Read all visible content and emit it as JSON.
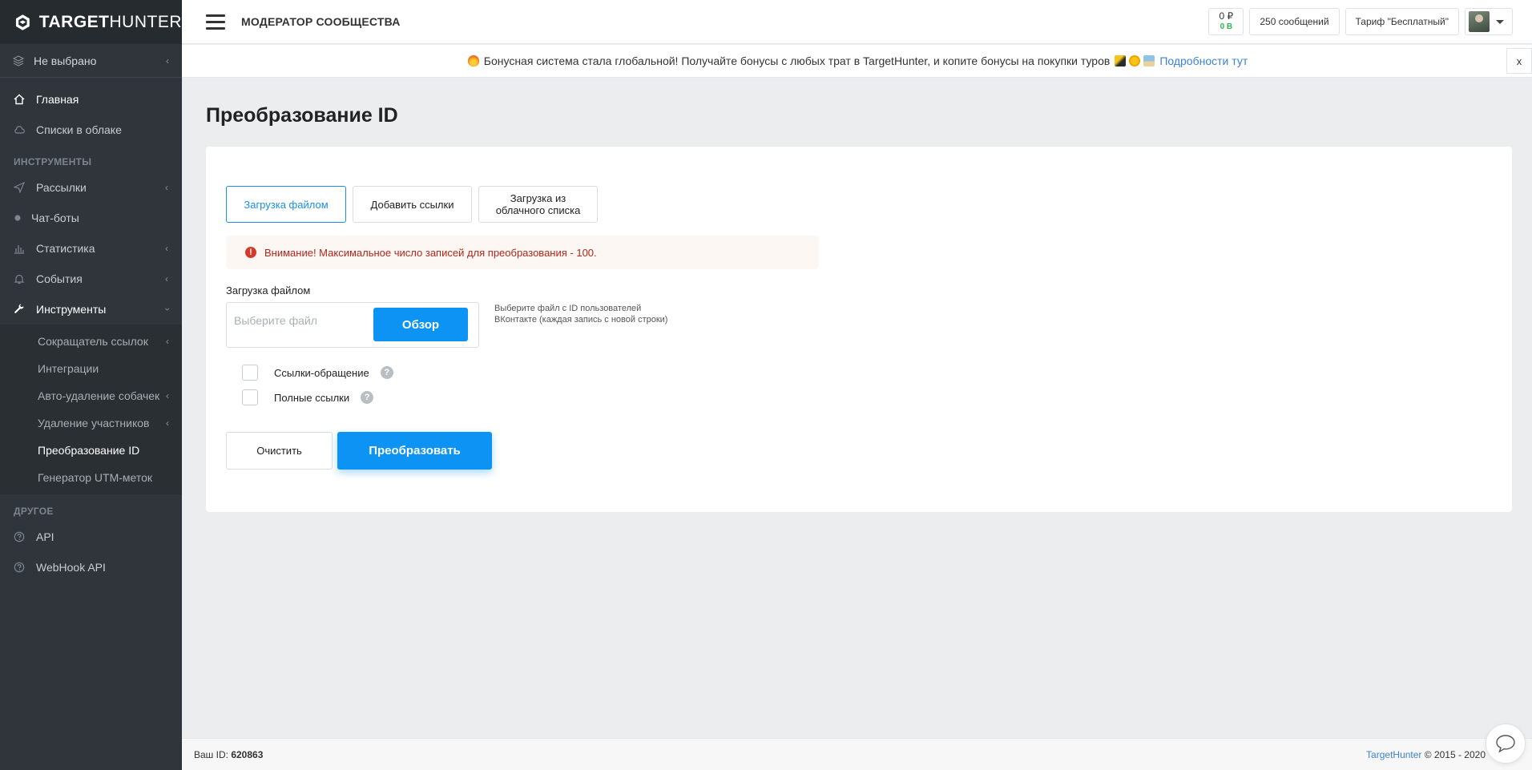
{
  "brand": {
    "name_bold": "TARGET",
    "name_regular": "HUNTER"
  },
  "sidebar": {
    "project_select": "Не выбрано",
    "main_items": [
      {
        "label": "Главная",
        "icon": "home-icon"
      },
      {
        "label": "Списки в облаке",
        "icon": "cloud-icon"
      }
    ],
    "section_tools": "ИНСТРУМЕНТЫ",
    "tool_items": [
      {
        "label": "Рассылки",
        "icon": "send-icon"
      },
      {
        "label": "Чат-боты",
        "icon": "bot-icon"
      },
      {
        "label": "Статистика",
        "icon": "chart-icon"
      },
      {
        "label": "События",
        "icon": "bell-icon"
      },
      {
        "label": "Инструменты",
        "icon": "wrench-icon"
      }
    ],
    "sub_items": [
      "Сокращатель ссылок",
      "Интеграции",
      "Авто-удаление собачек",
      "Удаление участников",
      "Преобразование ID",
      "Генератор UTM-меток"
    ],
    "section_other": "ДРУГОЕ",
    "other_items": [
      {
        "label": "API",
        "icon": "help-circle-icon"
      },
      {
        "label": "WebHook API",
        "icon": "help-circle-icon"
      }
    ]
  },
  "topbar": {
    "community_title": "МОДЕРАТОР СООБЩЕСТВА",
    "balance_rub": "0 ₽",
    "balance_bonus": "0 B",
    "messages": "250 сообщений",
    "tariff": "Тариф \"Бесплатный\""
  },
  "notice": {
    "text": "Бонусная система стала глобальной! Получайте бонусы с любых трат в TargetHunter, и копите бонусы на покупки туров",
    "link": "Подробности тут",
    "close": "x"
  },
  "page": {
    "title": "Преобразование ID",
    "tabs": [
      "Загрузка файлом",
      "Добавить ссылки",
      "Загрузка из облачного списка"
    ],
    "warning": "Внимание! Максимальное число записей для преобразования - 100.",
    "upload_label": "Загрузка файлом",
    "file_placeholder": "Выберите файл",
    "browse_label": "Обзор",
    "hint_line1": "Выберите файл с ID пользователей",
    "hint_line2": "ВКонтакте (каждая запись с новой строки)",
    "checkbox_links": "Ссылки-обращение",
    "checkbox_full": "Полные ссылки",
    "clear_label": "Очистить",
    "convert_label": "Преобразовать"
  },
  "footer": {
    "id_label": "Ваш ID:",
    "id_value": "620863",
    "brand": "TargetHunter",
    "copyright": "© 2015 - 2020"
  }
}
